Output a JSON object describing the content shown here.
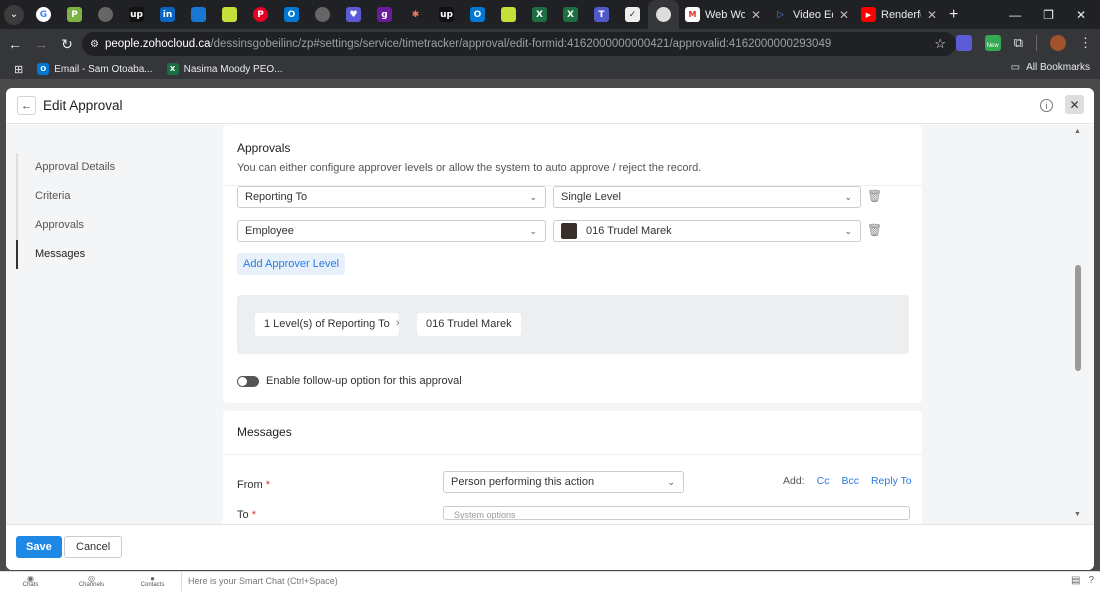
{
  "browser": {
    "tabs": [
      {
        "title": "Web Wor",
        "icon": "gmail-icon"
      },
      {
        "title": "Video Edi",
        "icon": "play-icon"
      },
      {
        "title": "Renderfo",
        "icon": "youtube-icon"
      }
    ],
    "url_host": "people.zohocloud.ca",
    "url_path": "/dessinsgobeilinc/zp#settings/service/timetracker/approval/edit-formid:4162000000000421/approvalid:4162000000293049",
    "bookmarks": [
      {
        "label": "Email - Sam Otoaba..."
      },
      {
        "label": "Nasima Moody PEO..."
      }
    ],
    "all_bookmarks": "All Bookmarks",
    "new_badge": "New"
  },
  "modal": {
    "title": "Edit Approval",
    "sidebar": [
      {
        "label": "Approval Details"
      },
      {
        "label": "Criteria"
      },
      {
        "label": "Approvals"
      },
      {
        "label": "Messages"
      }
    ],
    "approvals": {
      "title": "Approvals",
      "subtitle": "You can either configure approver levels or allow the system to auto approve / reject the record.",
      "rows": [
        {
          "type": "Reporting To",
          "value": "Single Level"
        },
        {
          "type": "Employee",
          "value": "016 Trudel Marek"
        }
      ],
      "add_level": "Add Approver Level",
      "summary": [
        "1 Level(s) of Reporting To",
        "016 Trudel Marek"
      ],
      "summary_arrow": "›",
      "followup_label": "Enable follow-up option for this approval",
      "followup_enabled": false
    },
    "messages": {
      "title": "Messages",
      "from_label": "From",
      "from_value": "Person performing this action",
      "add_label": "Add:",
      "cc": "Cc",
      "bcc": "Bcc",
      "reply_to": "Reply To",
      "to_label": "To",
      "to_placeholder": "System options"
    },
    "save": "Save",
    "cancel": "Cancel"
  },
  "bottom_bar": {
    "items": [
      "Chats",
      "Channels",
      "Contacts"
    ],
    "smart_chat": "Here is your Smart Chat (Ctrl+Space)"
  }
}
